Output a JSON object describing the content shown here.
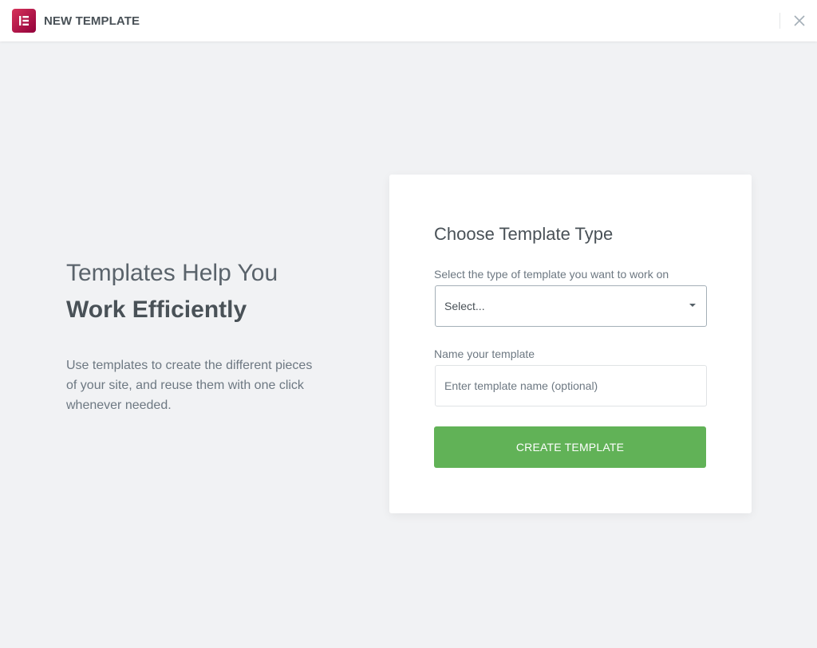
{
  "header": {
    "title": "NEW TEMPLATE",
    "logo_icon": "elementor-logo-icon",
    "close_icon": "close-icon"
  },
  "intro": {
    "title_line1": "Templates Help You",
    "title_line2": "Work Efficiently",
    "description": "Use templates to create the different pieces of your site, and reuse them with one click whenever needed."
  },
  "form": {
    "title": "Choose Template Type",
    "type_label": "Select the type of template you want to work on",
    "type_select": {
      "value": "Select..."
    },
    "name_label": "Name your template",
    "name_input": {
      "value": "",
      "placeholder": "Enter template name (optional)"
    },
    "submit_label": "CREATE TEMPLATE"
  },
  "colors": {
    "brand": "#92003b",
    "accent_button": "#61b257",
    "background": "#f1f2f4",
    "heading_text": "#495157"
  }
}
